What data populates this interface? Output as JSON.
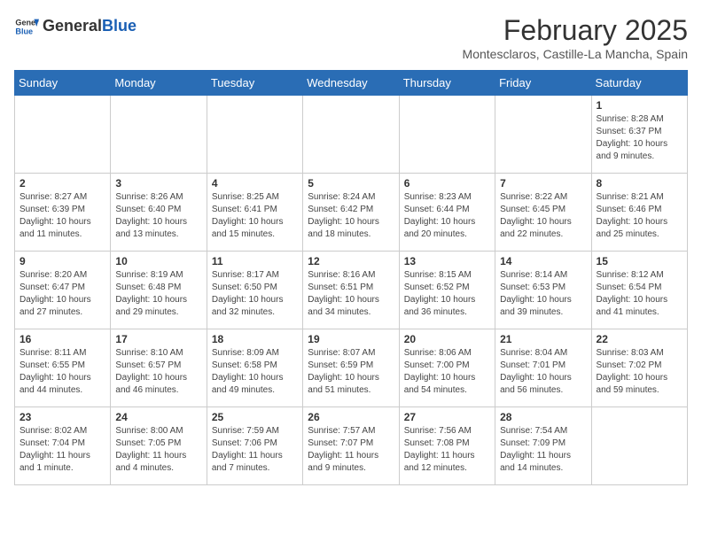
{
  "header": {
    "logo_general": "General",
    "logo_blue": "Blue",
    "month_title": "February 2025",
    "location": "Montesclaros, Castille-La Mancha, Spain"
  },
  "days_of_week": [
    "Sunday",
    "Monday",
    "Tuesday",
    "Wednesday",
    "Thursday",
    "Friday",
    "Saturday"
  ],
  "weeks": [
    [
      {
        "day": "",
        "info": ""
      },
      {
        "day": "",
        "info": ""
      },
      {
        "day": "",
        "info": ""
      },
      {
        "day": "",
        "info": ""
      },
      {
        "day": "",
        "info": ""
      },
      {
        "day": "",
        "info": ""
      },
      {
        "day": "1",
        "info": "Sunrise: 8:28 AM\nSunset: 6:37 PM\nDaylight: 10 hours and 9 minutes."
      }
    ],
    [
      {
        "day": "2",
        "info": "Sunrise: 8:27 AM\nSunset: 6:39 PM\nDaylight: 10 hours and 11 minutes."
      },
      {
        "day": "3",
        "info": "Sunrise: 8:26 AM\nSunset: 6:40 PM\nDaylight: 10 hours and 13 minutes."
      },
      {
        "day": "4",
        "info": "Sunrise: 8:25 AM\nSunset: 6:41 PM\nDaylight: 10 hours and 15 minutes."
      },
      {
        "day": "5",
        "info": "Sunrise: 8:24 AM\nSunset: 6:42 PM\nDaylight: 10 hours and 18 minutes."
      },
      {
        "day": "6",
        "info": "Sunrise: 8:23 AM\nSunset: 6:44 PM\nDaylight: 10 hours and 20 minutes."
      },
      {
        "day": "7",
        "info": "Sunrise: 8:22 AM\nSunset: 6:45 PM\nDaylight: 10 hours and 22 minutes."
      },
      {
        "day": "8",
        "info": "Sunrise: 8:21 AM\nSunset: 6:46 PM\nDaylight: 10 hours and 25 minutes."
      }
    ],
    [
      {
        "day": "9",
        "info": "Sunrise: 8:20 AM\nSunset: 6:47 PM\nDaylight: 10 hours and 27 minutes."
      },
      {
        "day": "10",
        "info": "Sunrise: 8:19 AM\nSunset: 6:48 PM\nDaylight: 10 hours and 29 minutes."
      },
      {
        "day": "11",
        "info": "Sunrise: 8:17 AM\nSunset: 6:50 PM\nDaylight: 10 hours and 32 minutes."
      },
      {
        "day": "12",
        "info": "Sunrise: 8:16 AM\nSunset: 6:51 PM\nDaylight: 10 hours and 34 minutes."
      },
      {
        "day": "13",
        "info": "Sunrise: 8:15 AM\nSunset: 6:52 PM\nDaylight: 10 hours and 36 minutes."
      },
      {
        "day": "14",
        "info": "Sunrise: 8:14 AM\nSunset: 6:53 PM\nDaylight: 10 hours and 39 minutes."
      },
      {
        "day": "15",
        "info": "Sunrise: 8:12 AM\nSunset: 6:54 PM\nDaylight: 10 hours and 41 minutes."
      }
    ],
    [
      {
        "day": "16",
        "info": "Sunrise: 8:11 AM\nSunset: 6:55 PM\nDaylight: 10 hours and 44 minutes."
      },
      {
        "day": "17",
        "info": "Sunrise: 8:10 AM\nSunset: 6:57 PM\nDaylight: 10 hours and 46 minutes."
      },
      {
        "day": "18",
        "info": "Sunrise: 8:09 AM\nSunset: 6:58 PM\nDaylight: 10 hours and 49 minutes."
      },
      {
        "day": "19",
        "info": "Sunrise: 8:07 AM\nSunset: 6:59 PM\nDaylight: 10 hours and 51 minutes."
      },
      {
        "day": "20",
        "info": "Sunrise: 8:06 AM\nSunset: 7:00 PM\nDaylight: 10 hours and 54 minutes."
      },
      {
        "day": "21",
        "info": "Sunrise: 8:04 AM\nSunset: 7:01 PM\nDaylight: 10 hours and 56 minutes."
      },
      {
        "day": "22",
        "info": "Sunrise: 8:03 AM\nSunset: 7:02 PM\nDaylight: 10 hours and 59 minutes."
      }
    ],
    [
      {
        "day": "23",
        "info": "Sunrise: 8:02 AM\nSunset: 7:04 PM\nDaylight: 11 hours and 1 minute."
      },
      {
        "day": "24",
        "info": "Sunrise: 8:00 AM\nSunset: 7:05 PM\nDaylight: 11 hours and 4 minutes."
      },
      {
        "day": "25",
        "info": "Sunrise: 7:59 AM\nSunset: 7:06 PM\nDaylight: 11 hours and 7 minutes."
      },
      {
        "day": "26",
        "info": "Sunrise: 7:57 AM\nSunset: 7:07 PM\nDaylight: 11 hours and 9 minutes."
      },
      {
        "day": "27",
        "info": "Sunrise: 7:56 AM\nSunset: 7:08 PM\nDaylight: 11 hours and 12 minutes."
      },
      {
        "day": "28",
        "info": "Sunrise: 7:54 AM\nSunset: 7:09 PM\nDaylight: 11 hours and 14 minutes."
      },
      {
        "day": "",
        "info": ""
      }
    ]
  ]
}
